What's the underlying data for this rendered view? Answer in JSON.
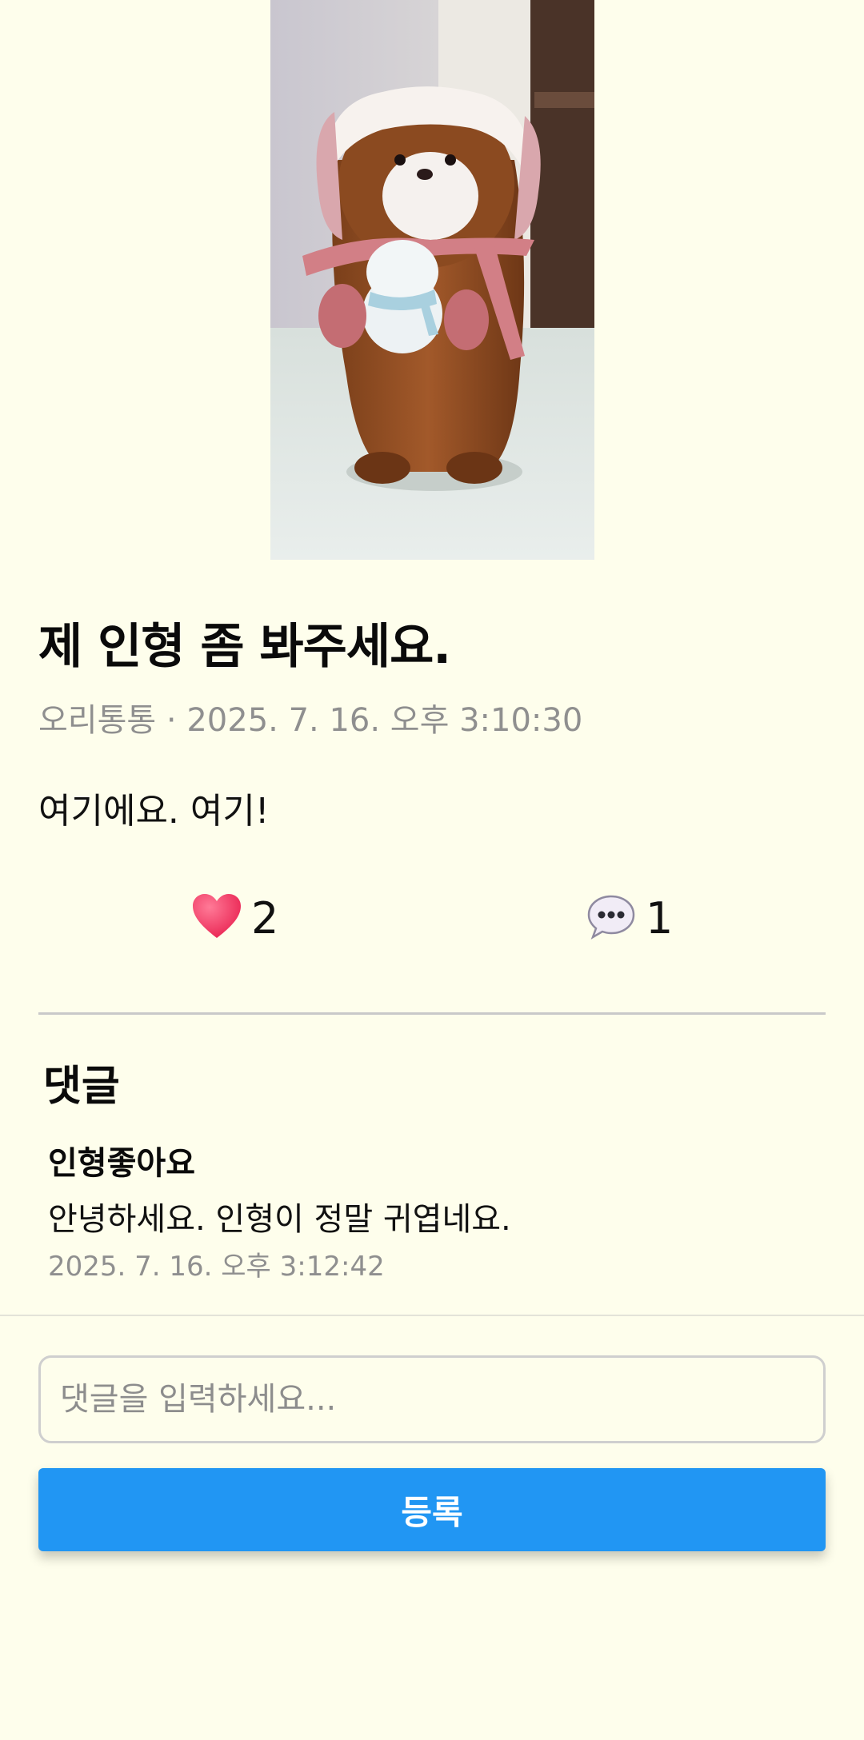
{
  "post": {
    "title": "제 인형 좀 봐주세요.",
    "meta": "오리통통 · 2025. 7. 16. 오후 3:10:30",
    "body": "여기에요. 여기!",
    "image_alt": "otter-plush-photo"
  },
  "reactions": {
    "likes": "2",
    "like_icon": "heart-icon",
    "comments": "1",
    "comment_icon": "speech-bubble-icon"
  },
  "comments_section": {
    "title": "댓글",
    "items": [
      {
        "author": "인형좋아요",
        "text": "안녕하세요. 인형이 정말 귀엽네요.",
        "time": "2025. 7. 16. 오후 3:12:42"
      }
    ]
  },
  "comment_form": {
    "placeholder": "댓글을 입력하세요...",
    "value": "",
    "submit_label": "등록"
  },
  "colors": {
    "background": "#fefeec",
    "accent": "#2196f3",
    "heart": "#f0285a"
  }
}
